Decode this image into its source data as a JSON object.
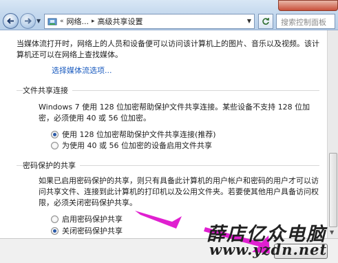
{
  "address_bar": {
    "crumbs": [
      "网络...",
      "高级共享设置"
    ],
    "overflow_marker": "«",
    "separator": "▸",
    "search_placeholder": "搜索控制面板"
  },
  "media": {
    "text": "当媒体流打开时，网络上的人员和设备便可以访问该计算机上的图片、音乐以及视频。该计算机还可以在网络上查找媒体。",
    "link": "选择媒体流选项..."
  },
  "file_sharing": {
    "title": "文件共享连接",
    "text": "Windows 7 使用 128 位加密帮助保护文件共享连接。某些设备不支持 128 位加密，必须使用 40 或 56 位加密。",
    "options": [
      {
        "label": "使用 128 位加密帮助保护文件共享连接(推荐)",
        "checked": true
      },
      {
        "label": "为使用 40 或 56 位加密的设备启用文件共享",
        "checked": false
      }
    ]
  },
  "password_sharing": {
    "title": "密码保护的共享",
    "text": "如果已启用密码保护的共享，则只有具备此计算机的用户帐户和密码的用户才可以访问共享文件、连接到此计算机的打印机以及公用文件夹。若要使其他用户具备访问权限，必须关闭密码保护共享。",
    "options": [
      {
        "label": "启用密码保护共享",
        "checked": false
      },
      {
        "label": "关闭密码保护共享",
        "checked": true
      }
    ]
  },
  "watermark": {
    "line1": "薛店亿众电脑",
    "line2": "www.yzdn.net"
  },
  "colors": {
    "link": "#1a5bbf",
    "arrow": "#e020d0",
    "radio_dot": "#2b5aa8"
  }
}
